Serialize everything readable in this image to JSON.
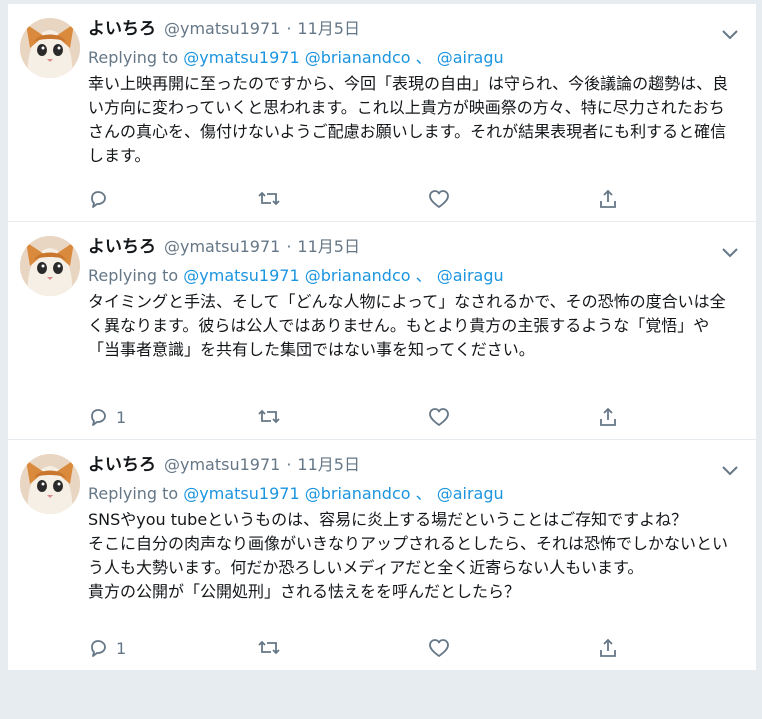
{
  "colors": {
    "background": "#e6ecf0",
    "card": "#ffffff",
    "text": "#14171a",
    "muted": "#657786",
    "link": "#1b95e0"
  },
  "tweets": [
    {
      "author_name": "よいちろ",
      "handle": "@ymatsu1971",
      "dot": "·",
      "time": "11月5日",
      "reply_prefix": "Replying to",
      "reply_mentions": "@ymatsu1971 @brianandco",
      "reply_sep": " 、",
      "reply_last": "@airagu",
      "text": "幸い上映再開に至ったのですから、今回「表現の自由」は守られ、今後議論の趨勢は、良い方向に変わっていくと思われます。これ以上貴方が映画祭の方々、特に尽力されたおちさんの真心を、傷付けないようご配慮お願いします。それが結果表現者にも利すると確信します。",
      "reply_count": "",
      "retweet_count": "",
      "like_count": ""
    },
    {
      "author_name": "よいちろ",
      "handle": "@ymatsu1971",
      "dot": "·",
      "time": "11月5日",
      "reply_prefix": "Replying to",
      "reply_mentions": "@ymatsu1971 @brianandco",
      "reply_sep": " 、",
      "reply_last": "@airagu",
      "text": "タイミングと手法、そして「どんな人物によって」なされるかで、その恐怖の度合いは全く異なります。彼らは公人ではありません。もとより貴方の主張するような「覚悟」や「当事者意識」を共有した集団ではない事を知ってください。",
      "reply_count": "1",
      "retweet_count": "",
      "like_count": ""
    },
    {
      "author_name": "よいちろ",
      "handle": "@ymatsu1971",
      "dot": "·",
      "time": "11月5日",
      "reply_prefix": "Replying to",
      "reply_mentions": "@ymatsu1971 @brianandco",
      "reply_sep": " 、",
      "reply_last": "@airagu",
      "text": "SNSやyou tubeというものは、容易に炎上する場だということはご存知ですよね？\nそこに自分の肉声なり画像がいきなりアップされるとしたら、それは恐怖でしかないという人も大勢います。何だか恐ろしいメディアだと全く近寄らない人もいます。\n貴方の公開が「公開処刑」される怯えをを呼んだとしたら？",
      "reply_count": "1",
      "retweet_count": "",
      "like_count": ""
    }
  ]
}
